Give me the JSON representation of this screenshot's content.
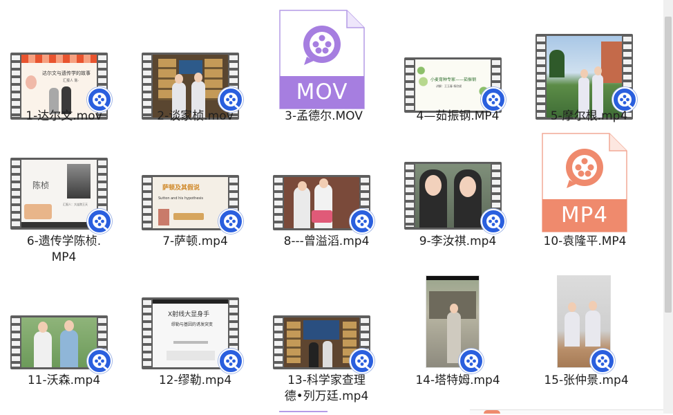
{
  "colors": {
    "mov": "#a67ee0",
    "mp4": "#ef8a6d",
    "badge": "#2a5fde"
  },
  "files": [
    {
      "name": "1-达尔文.mov",
      "thumb_text": "达尔文与遗传学的故事",
      "thumb_sub": "汇报人 陈·"
    },
    {
      "name": "2-谈家桢.mov"
    },
    {
      "name": "3-孟德尔.MOV",
      "ext": "MOV"
    },
    {
      "name": "4—茹振钢.MP4",
      "thumb_text": "小麦育种专家——茹振钢",
      "thumb_sub": "讲解：王玉春 杨欣妮"
    },
    {
      "name": "5-摩尔根.mp4"
    },
    {
      "name": "6-遗传学陈桢.",
      "name2": "MP4",
      "thumb_text": "陈桢",
      "thumb_sub": "汇报人：大连院王天"
    },
    {
      "name": "7-萨顿.mp4",
      "thumb_text": "萨顿及其假说",
      "thumb_sub": "Sutton and his hypothesis"
    },
    {
      "name": "8---曾溢滔.mp4"
    },
    {
      "name": "9-李汝祺.mp4"
    },
    {
      "name": "10-袁隆平.MP4",
      "ext": "MP4"
    },
    {
      "name": "11-沃森.mp4"
    },
    {
      "name": "12-缪勒.mp4",
      "thumb_text": "X射线大显身手",
      "thumb_sub": "缪勒与基因的诱发突变"
    },
    {
      "name": "13-科学家查理",
      "name2": "德•列万廷.mp4"
    },
    {
      "name": "14-塔特姆.mp4"
    },
    {
      "name": "15-张仲景.mp4"
    }
  ]
}
